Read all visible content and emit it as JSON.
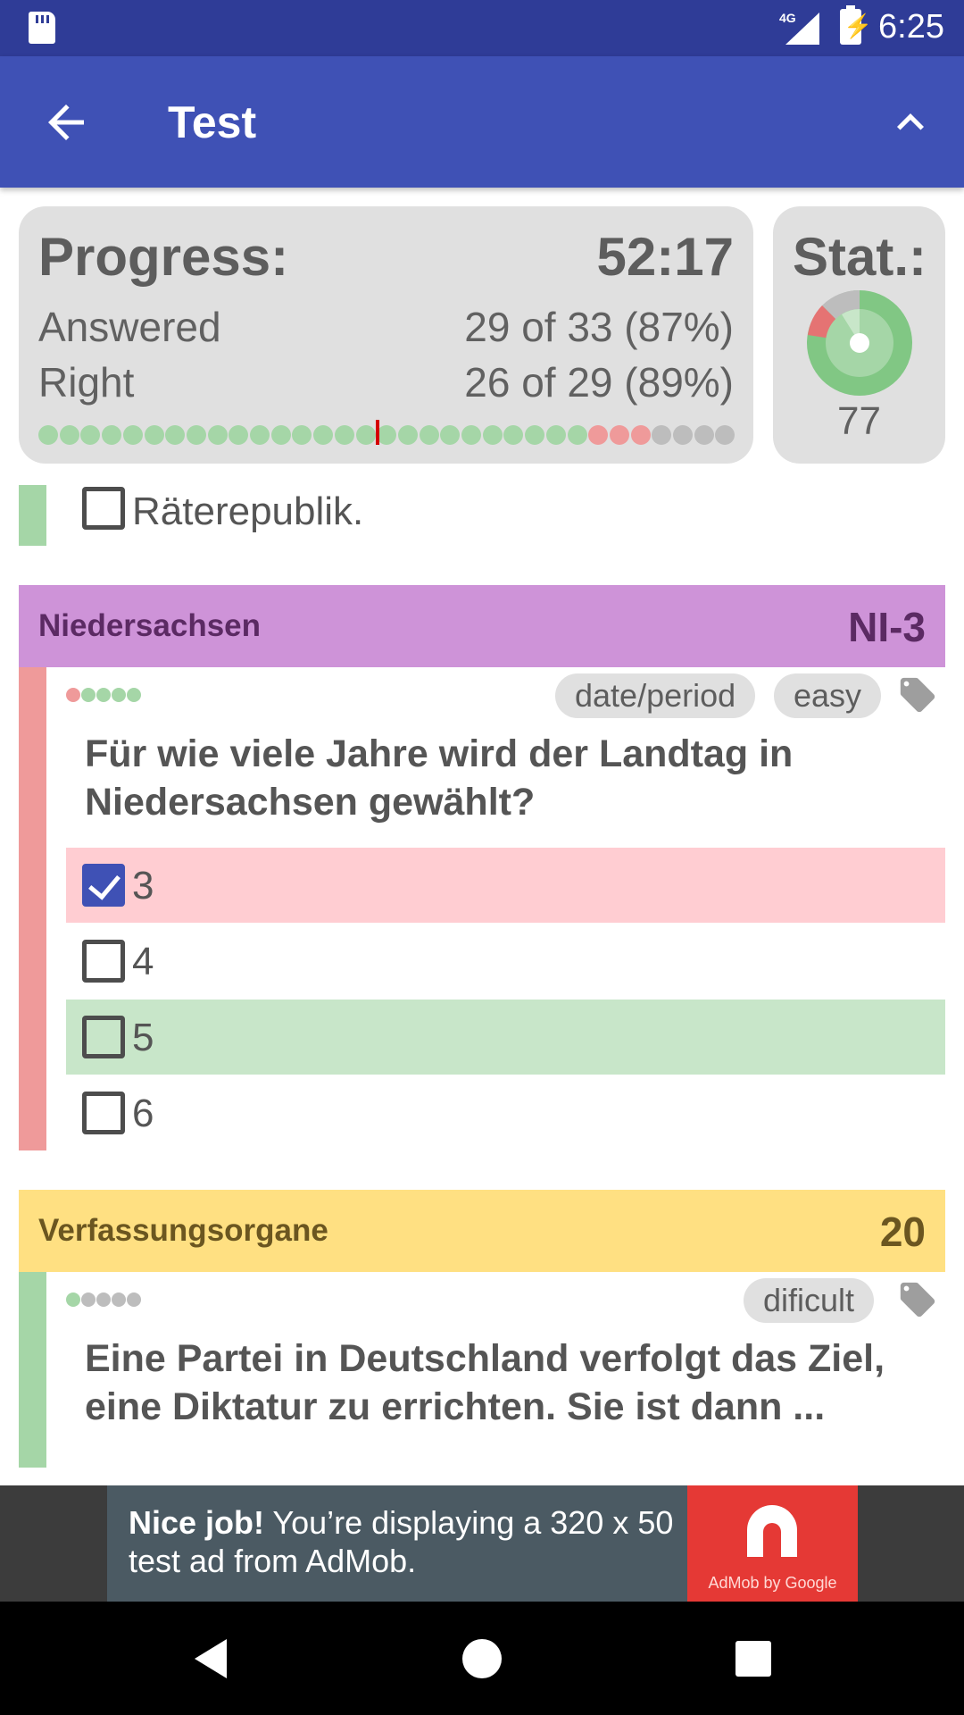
{
  "status_bar": {
    "network": "4G",
    "time": "6:25"
  },
  "app_bar": {
    "title": "Test"
  },
  "progress": {
    "title": "Progress:",
    "timer": "52:17",
    "answered_label": "Answered",
    "answered_value": "29 of 33 (87%)",
    "right_label": "Right",
    "right_value": "26 of 29 (89%)",
    "dot_states": [
      "g",
      "g",
      "g",
      "g",
      "g",
      "g",
      "g",
      "g",
      "g",
      "g",
      "g",
      "g",
      "g",
      "g",
      "g",
      "g",
      "g",
      "g",
      "g",
      "g",
      "g",
      "g",
      "g",
      "g",
      "g",
      "g",
      "r",
      "r",
      "r",
      "x",
      "x",
      "x",
      "x"
    ],
    "current_marker_after": 16
  },
  "stat": {
    "title": "Stat.:",
    "value": "77"
  },
  "previous_option": {
    "label": "Räterepublik."
  },
  "question_1": {
    "category": "Niedersachsen",
    "code": "NI-3",
    "tags": [
      "date/period",
      "easy"
    ],
    "history_dots": [
      "r",
      "g",
      "g",
      "g",
      "g"
    ],
    "text": "Für wie viele Jahre wird der Landtag in Niedersachsen gewählt?",
    "options": [
      {
        "label": "3",
        "checked": true,
        "state": "wrong"
      },
      {
        "label": "4",
        "checked": false,
        "state": "none"
      },
      {
        "label": "5",
        "checked": false,
        "state": "correct"
      },
      {
        "label": "6",
        "checked": false,
        "state": "none"
      }
    ]
  },
  "question_2": {
    "category": "Verfassungsorgane",
    "code": "20",
    "tags": [
      "dificult"
    ],
    "history_dots": [
      "g",
      "x",
      "x",
      "x",
      "x"
    ],
    "text": "Eine Partei in Deutschland verfolgt das Ziel, eine Diktatur zu errichten. Sie ist dann ..."
  },
  "ad": {
    "headline": "Nice job!",
    "body": " You’re displaying a 320 x 50 test ad from AdMob.",
    "logo_caption": "AdMob by Google"
  },
  "colors": {
    "primary": "#3f51b5",
    "primary_dark": "#2f3c97",
    "dot_green": "#a5d6a7",
    "dot_red": "#ef9a9a",
    "dot_grey": "#bdbdbd",
    "wrong_bg": "#ffcdd2",
    "correct_bg": "#c8e6c9",
    "cat_1": "#ce93d8",
    "cat_2": "#ffe082"
  }
}
